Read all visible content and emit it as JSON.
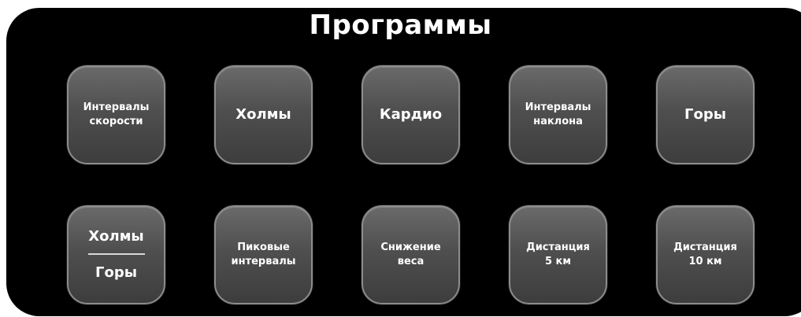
{
  "header": {
    "title": "Программы"
  },
  "programs": [
    {
      "line1": "Интервалы",
      "line2": "скорости"
    },
    {
      "line1": "Холмы",
      "line2": ""
    },
    {
      "line1": "Кардио",
      "line2": ""
    },
    {
      "line1": "Интервалы",
      "line2": "наклона"
    },
    {
      "line1": "Горы",
      "line2": ""
    },
    {
      "top": "Холмы",
      "bottom": "Горы"
    },
    {
      "line1": "Пиковые",
      "line2": "интервалы"
    },
    {
      "line1": "Снижение",
      "line2": "веса"
    },
    {
      "line1": "Дистанция",
      "line2": "5 км"
    },
    {
      "line1": "Дистанция",
      "line2": "10 км"
    }
  ],
  "colors": {
    "panel": "#000000",
    "button": "#4f4f4f",
    "button_border": "#8c8c8c",
    "text": "#ffffff"
  }
}
